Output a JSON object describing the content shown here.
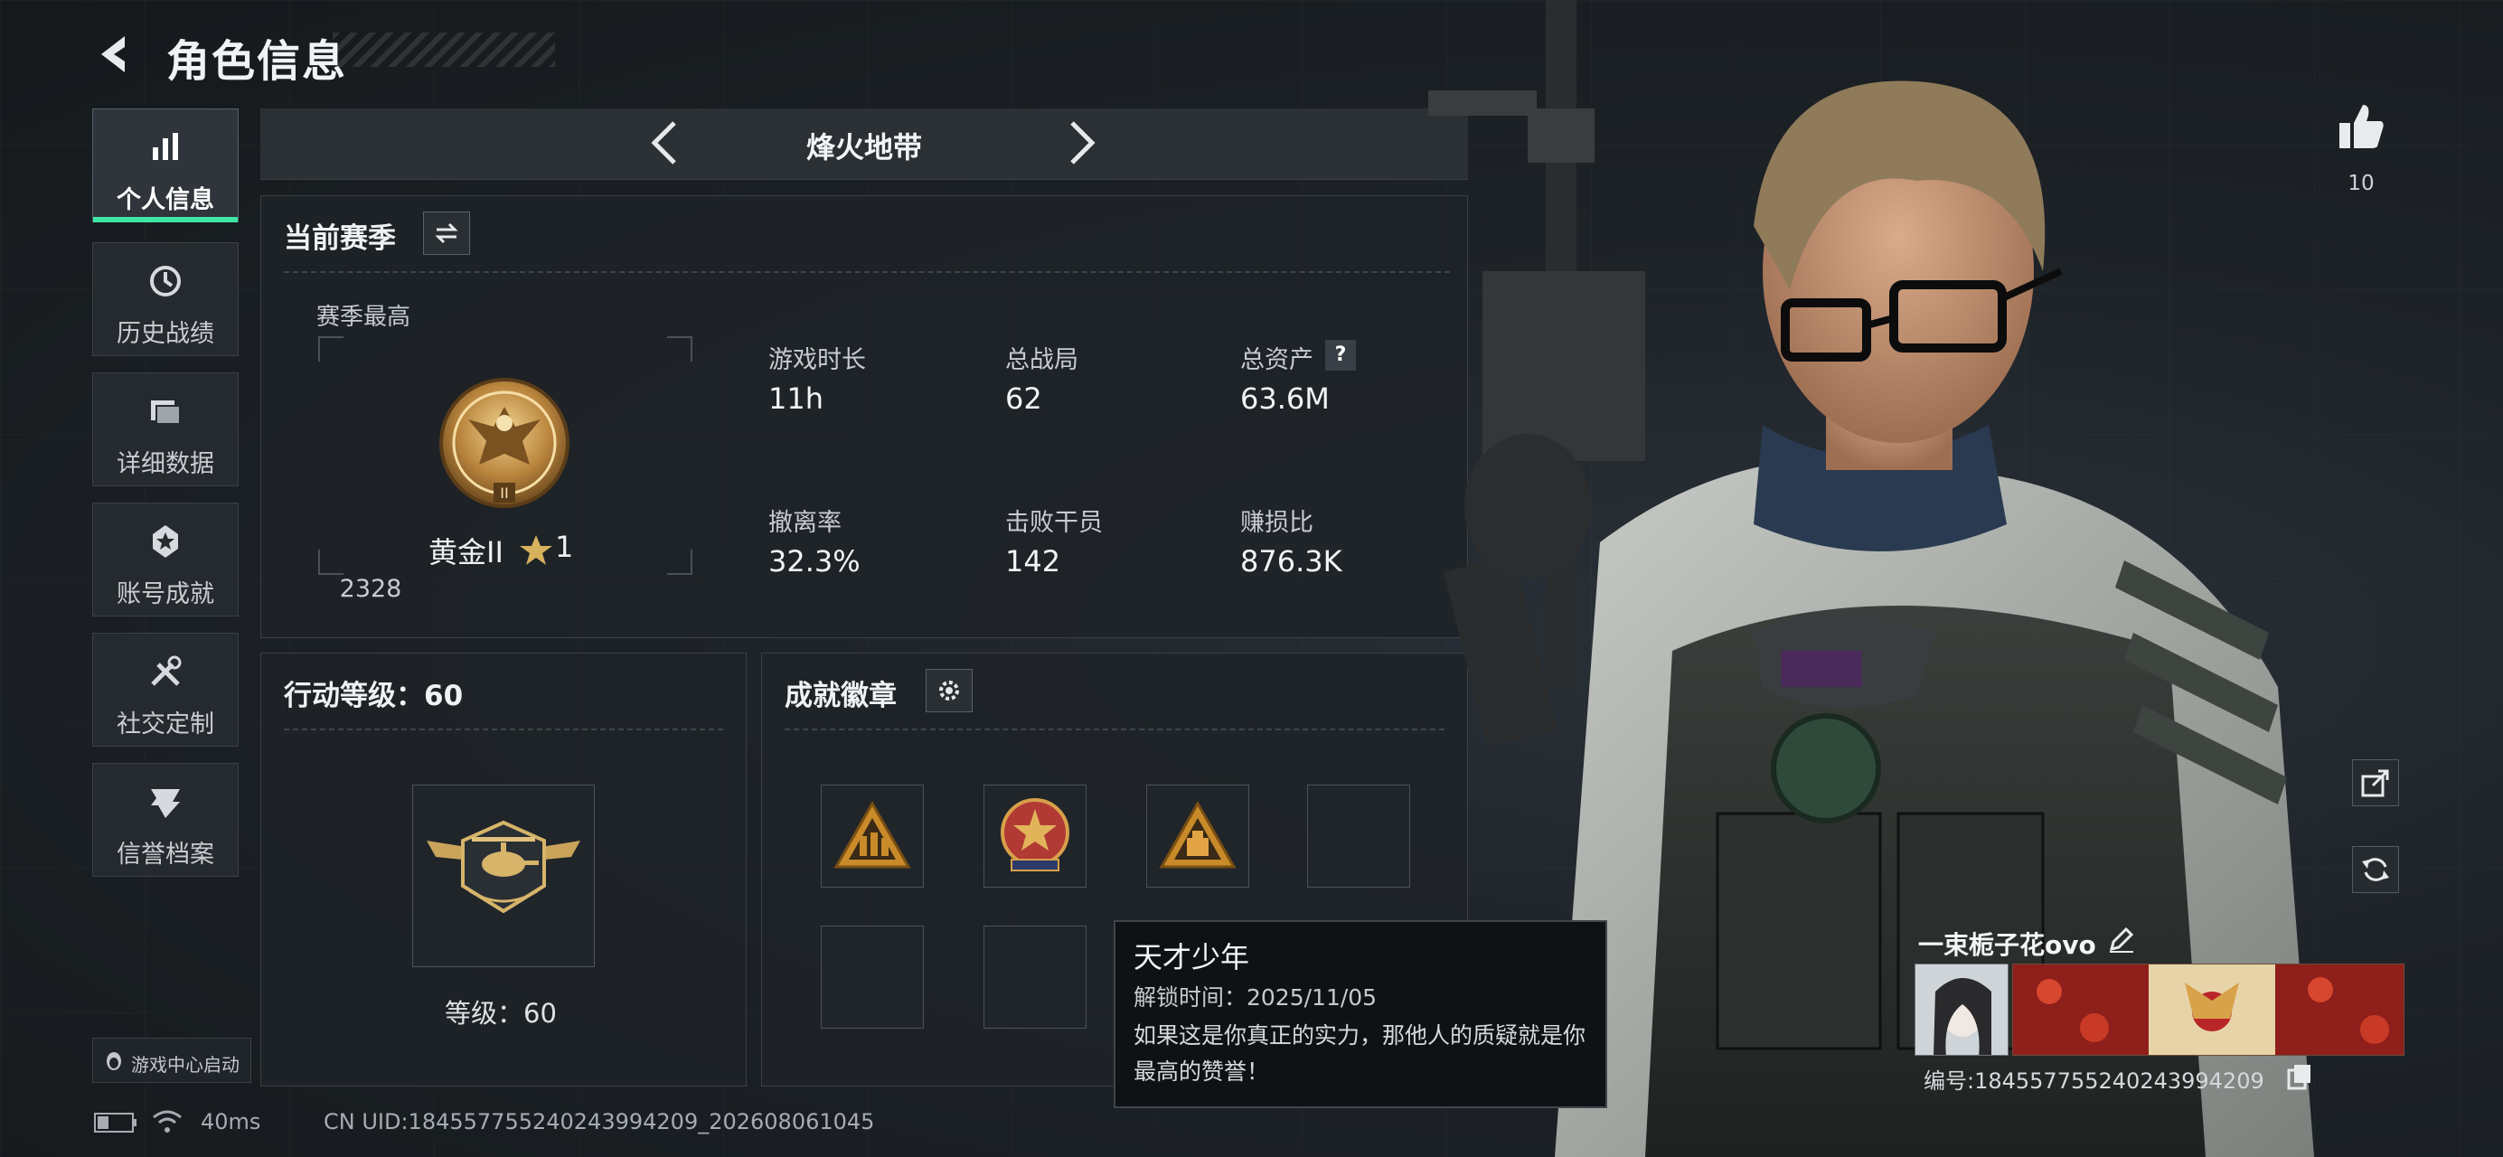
{
  "header": {
    "title": "角色信息"
  },
  "sidebar": {
    "items": [
      {
        "label": "个人信息",
        "icon": "bar-chart-icon",
        "active": true
      },
      {
        "label": "历史战绩",
        "icon": "history-icon",
        "active": false
      },
      {
        "label": "详细数据",
        "icon": "folder-icon",
        "active": false
      },
      {
        "label": "账号成就",
        "icon": "medal-icon",
        "active": false
      },
      {
        "label": "社交定制",
        "icon": "tools-icon",
        "active": false
      },
      {
        "label": "信誉档案",
        "icon": "credit-icon",
        "active": false
      }
    ],
    "game_center": "游戏中心启动"
  },
  "mode": {
    "title": "烽火地带"
  },
  "season": {
    "heading": "当前赛季",
    "best_label": "赛季最高",
    "rank_name": "黄金II",
    "rank_level": "1",
    "rank_score": "2328",
    "stats": [
      {
        "label": "游戏时长",
        "value": "11h"
      },
      {
        "label": "总战局",
        "value": "62"
      },
      {
        "label": "总资产",
        "value": "63.6M"
      },
      {
        "label": "撤离率",
        "value": "32.3%"
      },
      {
        "label": "击败干员",
        "value": "142"
      },
      {
        "label": "赚损比",
        "value": "876.3K"
      }
    ],
    "help_glyph": "?"
  },
  "level": {
    "heading": "行动等级：60",
    "caption": "等级：60"
  },
  "badges": {
    "heading": "成就徽章",
    "slots": [
      "badge-triangle-soldiers",
      "badge-star-emblem",
      "badge-triangle-crate",
      "empty",
      "empty",
      "empty"
    ]
  },
  "tooltip": {
    "title": "天才少年",
    "unlock_time": "解锁时间：2025/11/05",
    "description": "如果这是你真正的实力，那他人的质疑就是你最高的赞誉！"
  },
  "footer": {
    "ping": "40ms",
    "uid": "CN UID:18455775524024399420​9_202608061045"
  },
  "profile": {
    "likes": "10",
    "name": "一束栀子花ovo",
    "id_text": "编号:18455775524024399420​9"
  },
  "colors": {
    "accent": "#3fe6a4",
    "panel": "#1e2328",
    "gold": "#c89a4a"
  }
}
